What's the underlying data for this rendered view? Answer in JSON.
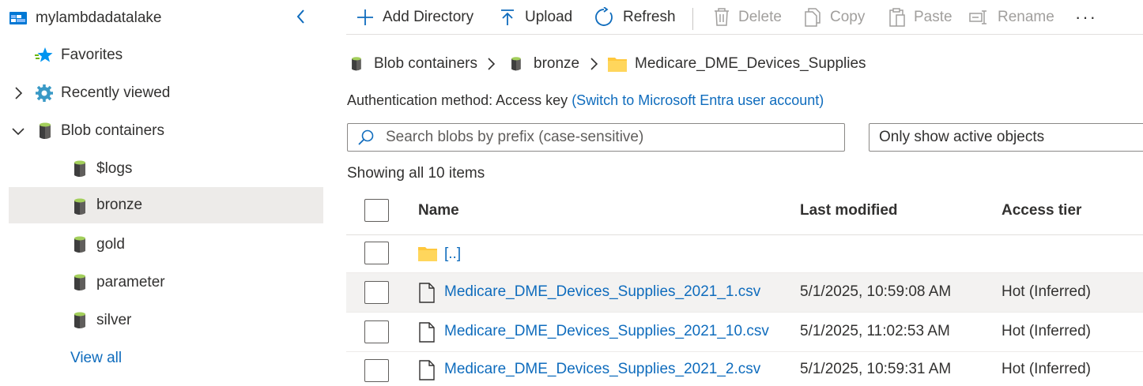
{
  "sidebar": {
    "account": "mylambdadatalake",
    "favorites": "Favorites",
    "recently_viewed": "Recently viewed",
    "blob_containers": "Blob containers",
    "containers": [
      "$logs",
      "bronze",
      "gold",
      "parameter",
      "silver"
    ],
    "selected_container": "bronze",
    "view_all": "View all"
  },
  "toolbar": {
    "add_directory": "Add Directory",
    "upload": "Upload",
    "refresh": "Refresh",
    "delete": "Delete",
    "copy": "Copy",
    "paste": "Paste",
    "rename": "Rename",
    "more": "···"
  },
  "breadcrumb": [
    "Blob containers",
    "bronze",
    "Medicare_DME_Devices_Supplies"
  ],
  "auth": {
    "label": "Authentication method:",
    "value": "Access key",
    "switch_link": "(Switch to Microsoft Entra user account)"
  },
  "search": {
    "placeholder": "Search blobs by prefix (case-sensitive)"
  },
  "filter": {
    "selected": "Only show active objects"
  },
  "showing": "Showing all 10 items",
  "table": {
    "columns": {
      "name": "Name",
      "modified": "Last modified",
      "tier": "Access tier"
    },
    "parent": "[..]",
    "rows": [
      {
        "name": "Medicare_DME_Devices_Supplies_2021_1.csv",
        "modified": "5/1/2025, 10:59:08 AM",
        "tier": "Hot (Inferred)"
      },
      {
        "name": "Medicare_DME_Devices_Supplies_2021_10.csv",
        "modified": "5/1/2025, 11:02:53 AM",
        "tier": "Hot (Inferred)"
      },
      {
        "name": "Medicare_DME_Devices_Supplies_2021_2.csv",
        "modified": "5/1/2025, 10:59:31 AM",
        "tier": "Hot (Inferred)"
      }
    ]
  },
  "colors": {
    "link": "#0f6cbd",
    "selected_bg": "#edebe9",
    "hover_row": "#f3f2f1",
    "folder": "#ffc83d"
  }
}
